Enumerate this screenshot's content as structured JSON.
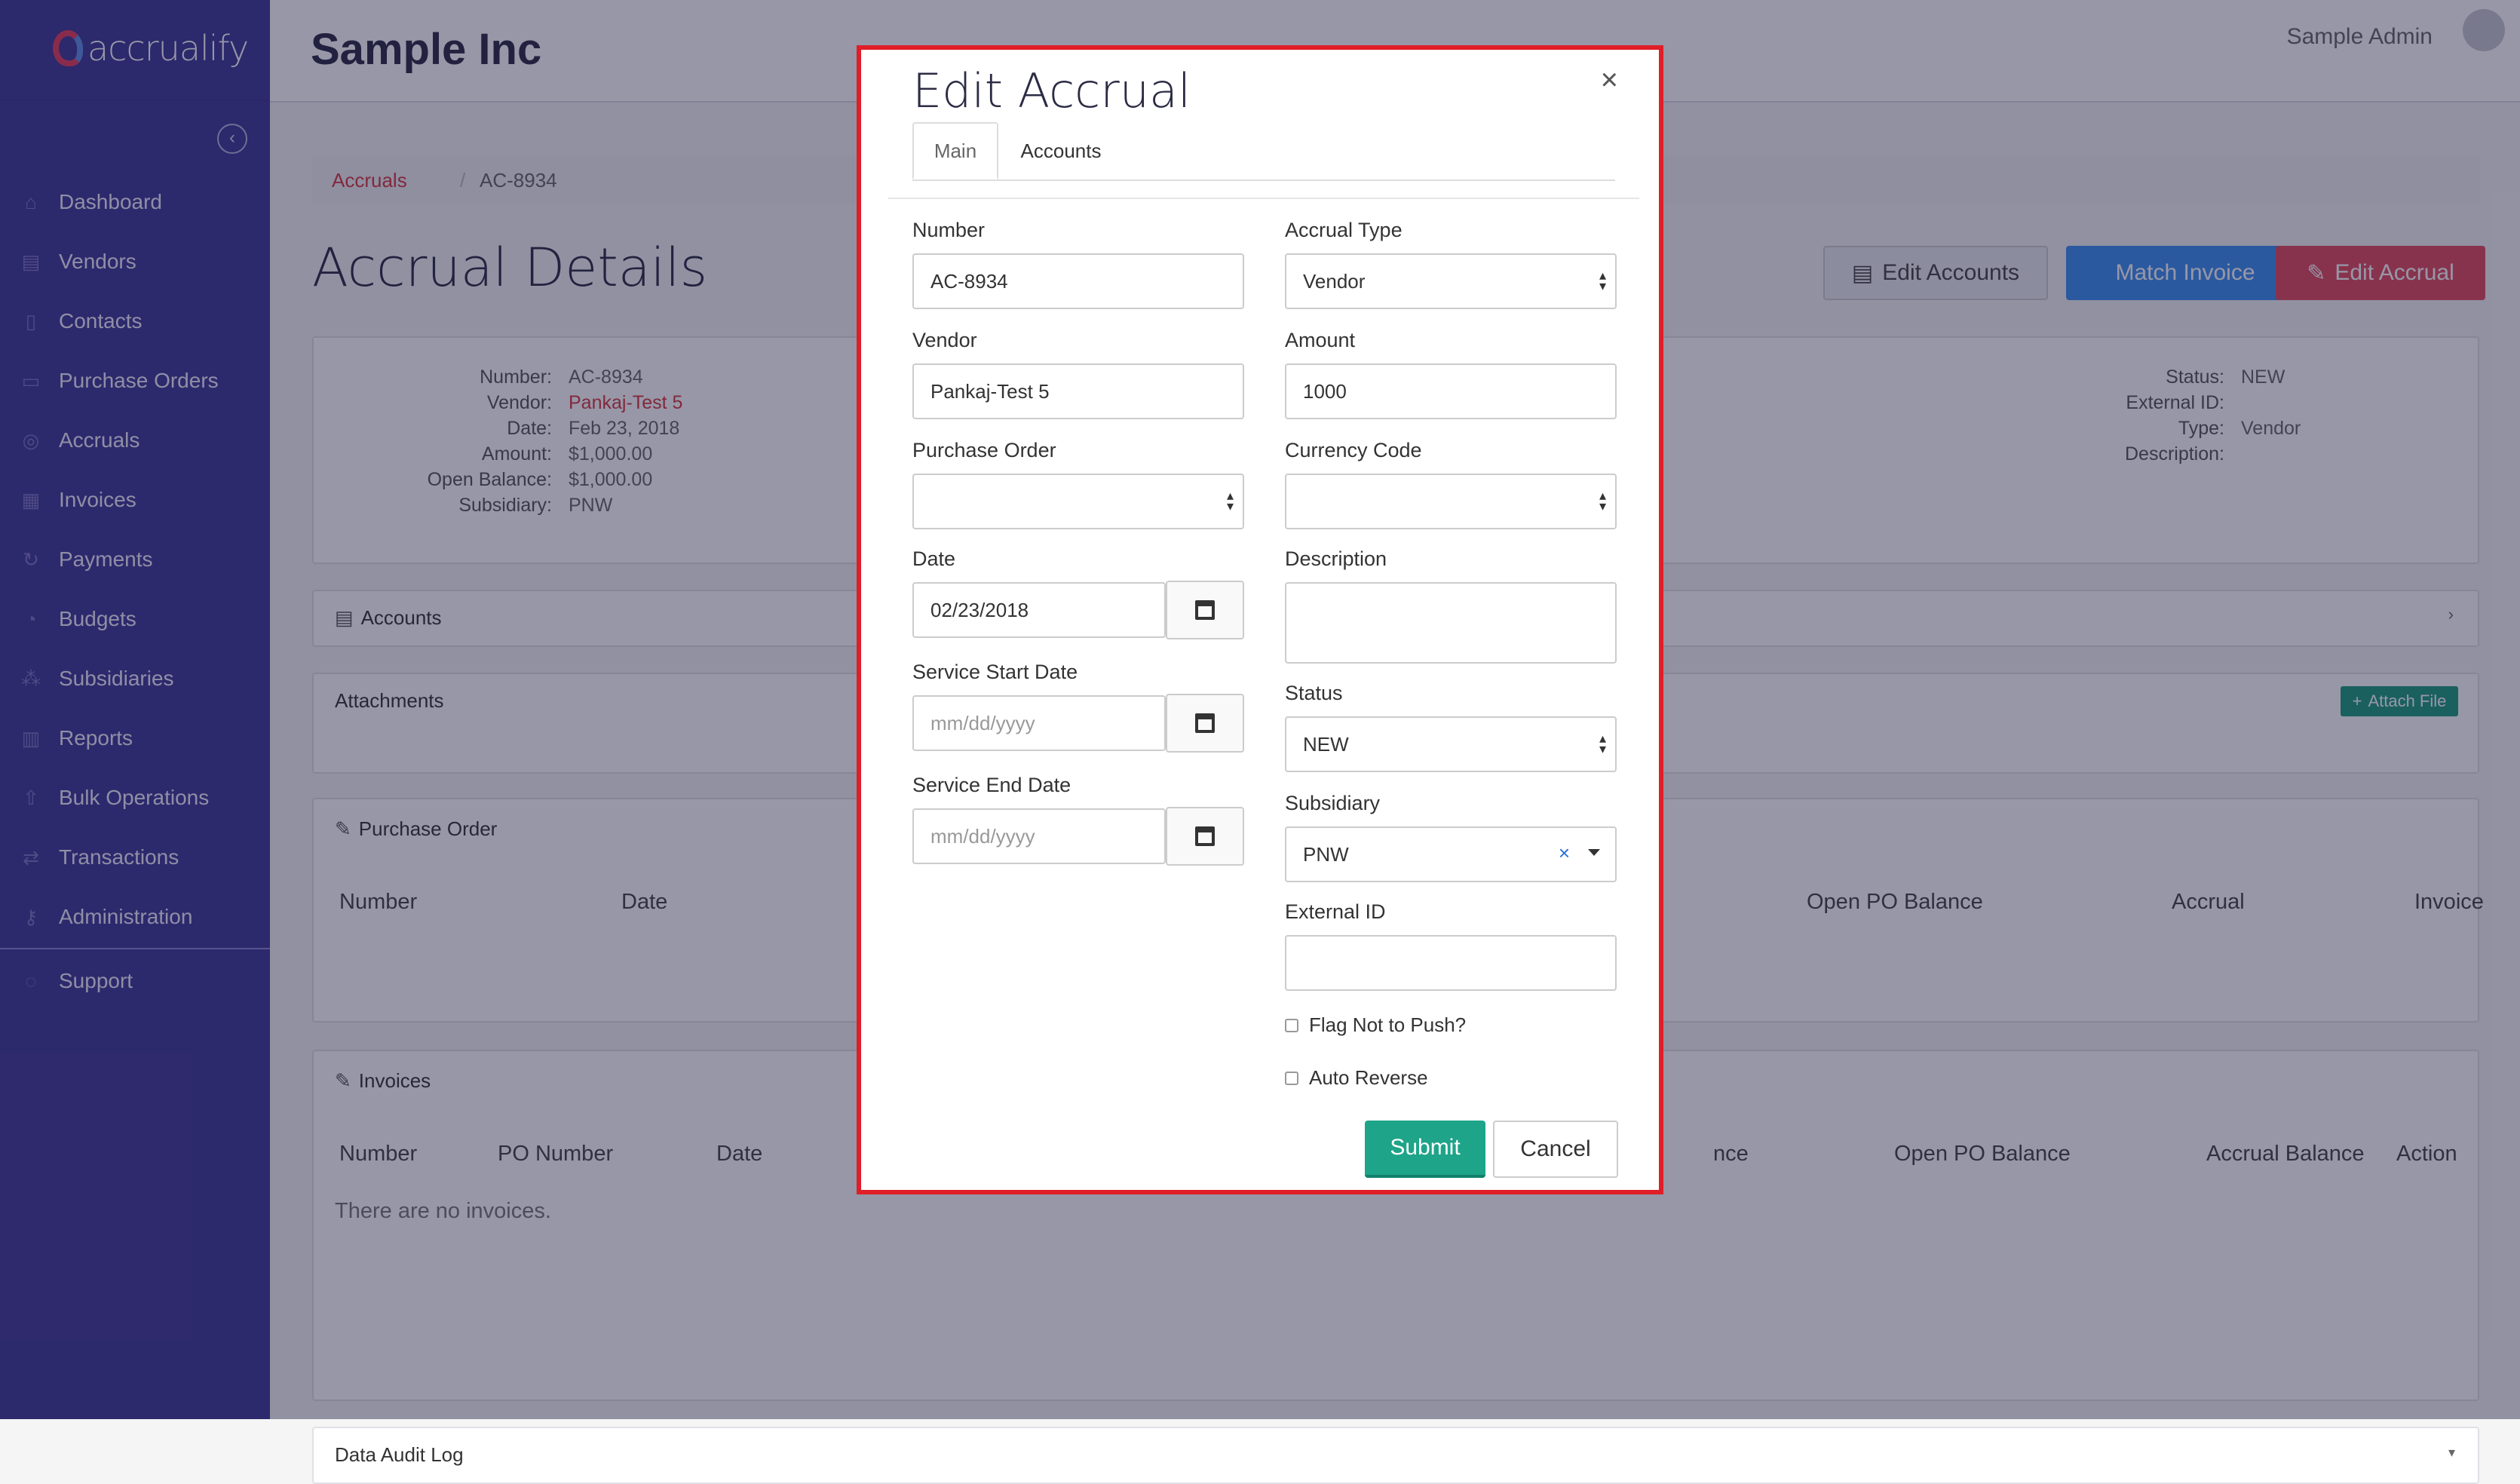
{
  "app": {
    "logo_text": "accrualify"
  },
  "sidebar": {
    "items": [
      {
        "label": "Dashboard",
        "icon": "home-icon"
      },
      {
        "label": "Vendors",
        "icon": "vendors-icon"
      },
      {
        "label": "Contacts",
        "icon": "contacts-icon"
      },
      {
        "label": "Purchase Orders",
        "icon": "cart-icon"
      },
      {
        "label": "Accruals",
        "icon": "accruals-icon"
      },
      {
        "label": "Invoices",
        "icon": "invoice-icon"
      },
      {
        "label": "Payments",
        "icon": "payments-icon"
      },
      {
        "label": "Budgets",
        "icon": "budgets-icon"
      },
      {
        "label": "Subsidiaries",
        "icon": "subsidiaries-icon"
      },
      {
        "label": "Reports",
        "icon": "reports-icon"
      },
      {
        "label": "Bulk Operations",
        "icon": "upload-icon"
      },
      {
        "label": "Transactions",
        "icon": "transactions-icon"
      },
      {
        "label": "Administration",
        "icon": "key-icon"
      }
    ],
    "support_label": "Support"
  },
  "header": {
    "company": "Sample Inc",
    "user": "Sample Admin"
  },
  "breadcrumb": {
    "root": "Accruals",
    "separator": "/",
    "current": "AC-8934"
  },
  "page": {
    "title": "Accrual Details",
    "buttons": {
      "edit_accounts": "Edit Accounts",
      "match_invoice": "Match Invoice",
      "edit_accrual": "Edit Accrual"
    }
  },
  "details": {
    "left": [
      {
        "k": "Number:",
        "v": "AC-8934"
      },
      {
        "k": "Vendor:",
        "v": "Pankaj-Test 5"
      },
      {
        "k": "Date:",
        "v": "Feb 23, 2018"
      },
      {
        "k": "Amount:",
        "v": "$1,000.00"
      },
      {
        "k": "Open Balance:",
        "v": "$1,000.00"
      },
      {
        "k": "Subsidiary:",
        "v": "PNW"
      }
    ],
    "right": [
      {
        "k": "Status:",
        "v": "NEW"
      },
      {
        "k": "External ID:",
        "v": ""
      },
      {
        "k": "Type:",
        "v": "Vendor"
      },
      {
        "k": "Description:",
        "v": ""
      }
    ]
  },
  "sections": {
    "accounts": "Accounts",
    "attachments": "Attachments",
    "attach_file": "Attach File",
    "purchase_order": "Purchase Order",
    "po_columns": [
      "Number",
      "Date",
      "Open PO Balance",
      "Accrual",
      "Invoice"
    ],
    "invoices": "Invoices",
    "invoice_columns": [
      "Number",
      "PO Number",
      "Date",
      "nce",
      "Open PO Balance",
      "Accrual Balance",
      "Action"
    ],
    "no_invoices": "There are no invoices.",
    "audit_log": "Data Audit Log"
  },
  "modal": {
    "title": "Edit Accrual",
    "close": "×",
    "tabs": [
      "Main",
      "Accounts"
    ],
    "fields": {
      "number": {
        "label": "Number",
        "value": "AC-8934"
      },
      "vendor": {
        "label": "Vendor",
        "value": "Pankaj-Test 5"
      },
      "purchase_order": {
        "label": "Purchase Order",
        "value": ""
      },
      "date": {
        "label": "Date",
        "value": "02/23/2018"
      },
      "service_start": {
        "label": "Service Start Date",
        "placeholder": "mm/dd/yyyy"
      },
      "service_end": {
        "label": "Service End Date",
        "placeholder": "mm/dd/yyyy"
      },
      "accrual_type": {
        "label": "Accrual Type",
        "value": "Vendor"
      },
      "amount": {
        "label": "Amount",
        "value": "1000"
      },
      "currency_code": {
        "label": "Currency Code",
        "value": ""
      },
      "description": {
        "label": "Description",
        "value": ""
      },
      "status": {
        "label": "Status",
        "value": "NEW"
      },
      "subsidiary": {
        "label": "Subsidiary",
        "value": "PNW",
        "clear": "×"
      },
      "external_id": {
        "label": "External ID",
        "value": ""
      },
      "flag_not_push": {
        "label": "Flag Not to Push?"
      },
      "auto_reverse": {
        "label": "Auto Reverse"
      }
    },
    "submit": "Submit",
    "cancel": "Cancel"
  },
  "colors": {
    "sidebar": "#3f3896",
    "accent_red": "#e34a5c",
    "accent_blue": "#3b8ef0",
    "submit_green": "#1ea488"
  }
}
